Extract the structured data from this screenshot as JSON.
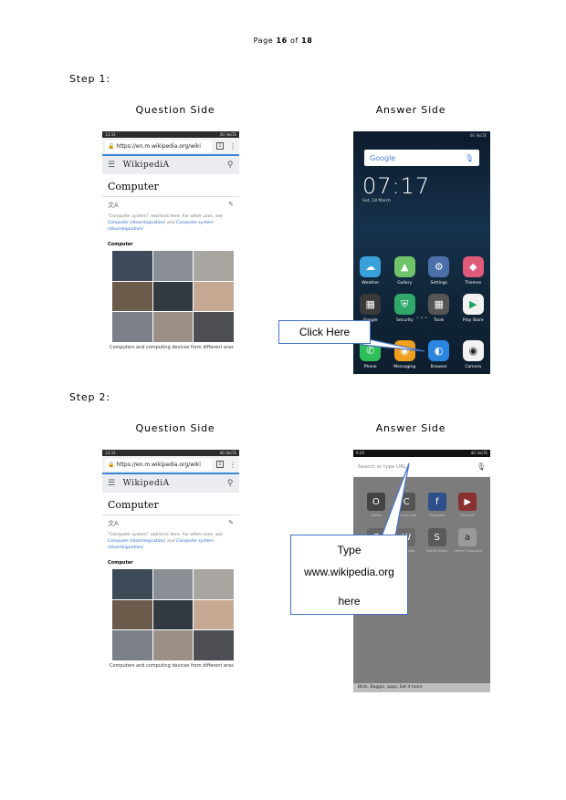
{
  "page": {
    "label": "Page",
    "current": "16",
    "of": "of",
    "total": "18"
  },
  "steps": [
    {
      "label": "Step 1:",
      "question_label": "Question Side",
      "answer_label": "Answer Side"
    },
    {
      "label": "Step 2:",
      "question_label": "Question Side",
      "answer_label": "Answer Side"
    }
  ],
  "wiki": {
    "status_time": "13:33",
    "status_right": "4G VoLTE",
    "url": "https://en.m.wikipedia.org/wiki",
    "tabs_count": "1",
    "brand": "WikipediA",
    "title": "Computer",
    "note_text": "\"Computer system\" redirects here. For other uses, see",
    "note_link1": "Computer (disambiguation)",
    "note_and": "and",
    "note_link2": "Computer system (disambiguation)",
    "caption_title": "Computer",
    "caption": "Computers and computing devices from different eras"
  },
  "home": {
    "status": "4G VoLTE",
    "search_logo": "Google",
    "time": "07:17",
    "date": "Sat, 18 March",
    "apps_row1": [
      "Weather",
      "Gallery",
      "Settings",
      "Themes"
    ],
    "apps_row2": [
      "Google",
      "Security",
      "Tools",
      "Play Store"
    ],
    "apps_row3": [
      "Phone",
      "Messaging",
      "Browser",
      "Camera"
    ],
    "colors": {
      "weather": "#39a0d8",
      "gallery": "#6fc46a",
      "settings": "#4b6fa8",
      "themes": "#e05a7a",
      "google": "#3a3a3a",
      "security": "#2fa86a",
      "tools": "#555555",
      "play": "#f2f2f2",
      "phone": "#2fbf5a",
      "messaging": "#f0a020",
      "browser": "#2b86e0",
      "camera": "#f2f2f2"
    }
  },
  "browser": {
    "status_time": "9:20",
    "placeholder": "Search or type URL",
    "tiles": [
      "Opera",
      "Cricket Live",
      "Facebook",
      "YouTube",
      "Google",
      "Wikipedia",
      "Social Media",
      "Online Shopping"
    ],
    "news": "Blick, Baggie, apps, Set it more"
  },
  "callouts": {
    "step1": "Click Here",
    "step2_line1": "Type",
    "step2_line2": "www.wikipedia.org",
    "step2_line3": "here"
  }
}
